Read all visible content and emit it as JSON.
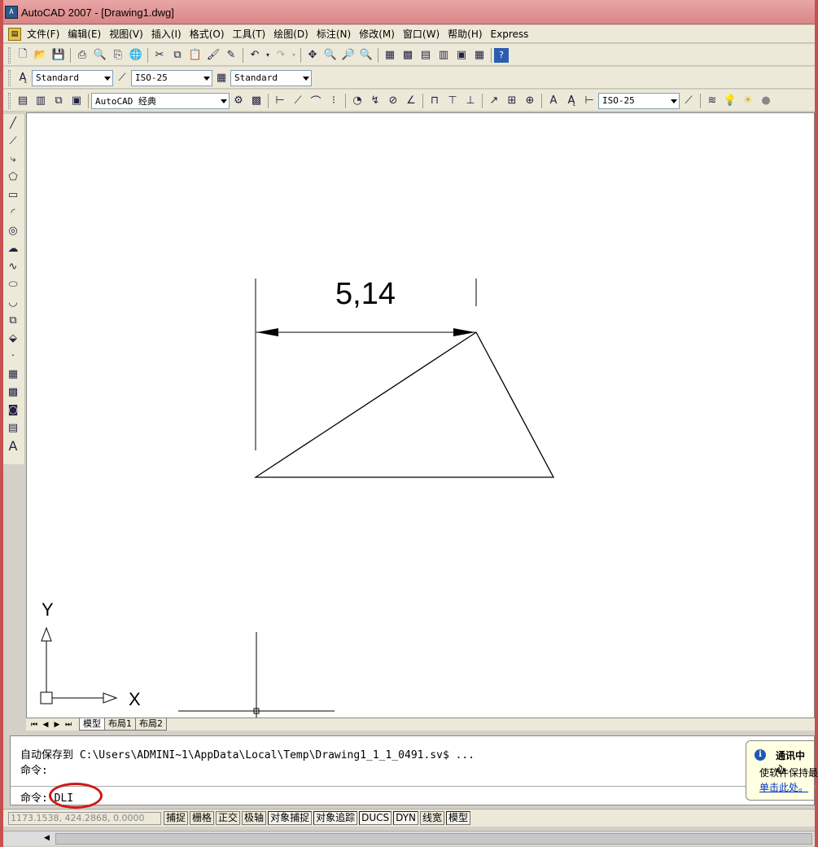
{
  "window": {
    "title": "AutoCAD 2007 - [Drawing1.dwg]"
  },
  "menu": [
    "文件(F)",
    "编辑(E)",
    "视图(V)",
    "插入(I)",
    "格式(O)",
    "工具(T)",
    "绘图(D)",
    "标注(N)",
    "修改(M)",
    "窗口(W)",
    "帮助(H)",
    "Express"
  ],
  "styles_toolbar": {
    "text_style": "Standard",
    "dim_style": "ISO-25",
    "table_style": "Standard"
  },
  "workspace_toolbar": {
    "workspace": "AutoCAD 经典",
    "dim_style": "ISO-25"
  },
  "drawing": {
    "dimension_text": "5,14"
  },
  "ucs": {
    "x_label": "X",
    "y_label": "Y"
  },
  "tabs": [
    "模型",
    "布局1",
    "布局2"
  ],
  "command": {
    "line1": "自动保存到 C:\\Users\\ADMINI~1\\AppData\\Local\\Temp\\Drawing1_1_1_0491.sv$ ...",
    "line2": "命令:",
    "prompt": "命令:",
    "input": "DLI"
  },
  "balloon": {
    "title": "通讯中心",
    "text": "使软件保持最新",
    "link": "单击此处。"
  },
  "status": {
    "coords": "1173.1538,  424.2868,  0.0000",
    "buttons": [
      "捕捉",
      "栅格",
      "正交",
      "极轴",
      "对象捕捉",
      "对象追踪",
      "DUCS",
      "DYN",
      "线宽",
      "模型"
    ]
  }
}
